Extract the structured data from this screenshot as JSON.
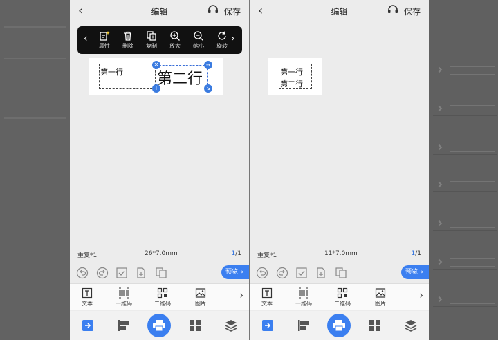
{
  "screens": {
    "left": {
      "header": {
        "title": "编辑",
        "save_label": "保存"
      },
      "toolbar": {
        "items": [
          {
            "label": "属性",
            "icon": "edit-sparkle-icon"
          },
          {
            "label": "删除",
            "icon": "trash-icon"
          },
          {
            "label": "复制",
            "icon": "copy-icon"
          },
          {
            "label": "放大",
            "icon": "zoom-in-icon"
          },
          {
            "label": "缩小",
            "icon": "zoom-out-icon"
          },
          {
            "label": "旋转",
            "icon": "rotate-icon"
          }
        ]
      },
      "canvas": {
        "line1": "第一行",
        "line2": "第二行"
      },
      "status": {
        "repeat": "重复*1",
        "size": "26*7.0mm",
        "page_current": "1",
        "page_total": "/1"
      },
      "preview_label": "预览"
    },
    "right": {
      "header": {
        "title": "编辑",
        "save_label": "保存"
      },
      "canvas": {
        "line1": "第一行",
        "line2": "第二行"
      },
      "status": {
        "repeat": "重复*1",
        "size": "11*7.0mm",
        "page_current": "1",
        "page_total": "/1"
      },
      "preview_label": "预览"
    }
  },
  "elements_bar": [
    {
      "label": "文本",
      "icon": "text-icon"
    },
    {
      "label": "一维码",
      "icon": "barcode-icon"
    },
    {
      "label": "二维码",
      "icon": "qrcode-icon"
    },
    {
      "label": "图片",
      "icon": "image-icon"
    }
  ],
  "bottom_nav": [
    "import-icon",
    "align-icon",
    "print-icon",
    "template-icon",
    "layers-icon"
  ],
  "colors": {
    "accent": "#3b7ff0",
    "toolbar_bg": "#111111",
    "screen_bg": "#ececec"
  }
}
